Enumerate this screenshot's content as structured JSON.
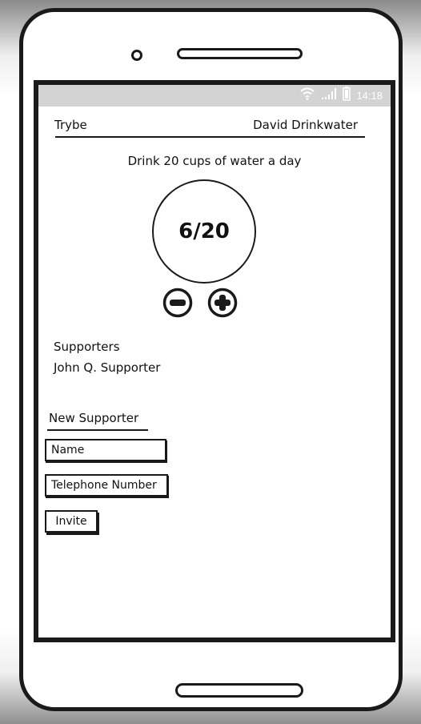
{
  "status_bar": {
    "time": "14:18",
    "icons": [
      "wifi-icon",
      "signal-icon",
      "battery-icon"
    ]
  },
  "header": {
    "app_title": "Trybe",
    "user_name": "David Drinkwater"
  },
  "goal": {
    "text": "Drink 20 cups of water a day",
    "progress_label": "6/20",
    "current": 6,
    "target": 20,
    "decrement_icon": "minus-circle-icon",
    "increment_icon": "plus-circle-icon"
  },
  "supporters": {
    "heading": "Supporters",
    "items": [
      "John Q. Supporter"
    ]
  },
  "new_supporter": {
    "heading": "New Supporter",
    "name_placeholder": "Name",
    "phone_placeholder": "Telephone Number",
    "invite_label": "Invite"
  },
  "colors": {
    "ink": "#1a1a1a",
    "status_bar": "#d3d3d3",
    "background": "#ffffff"
  }
}
